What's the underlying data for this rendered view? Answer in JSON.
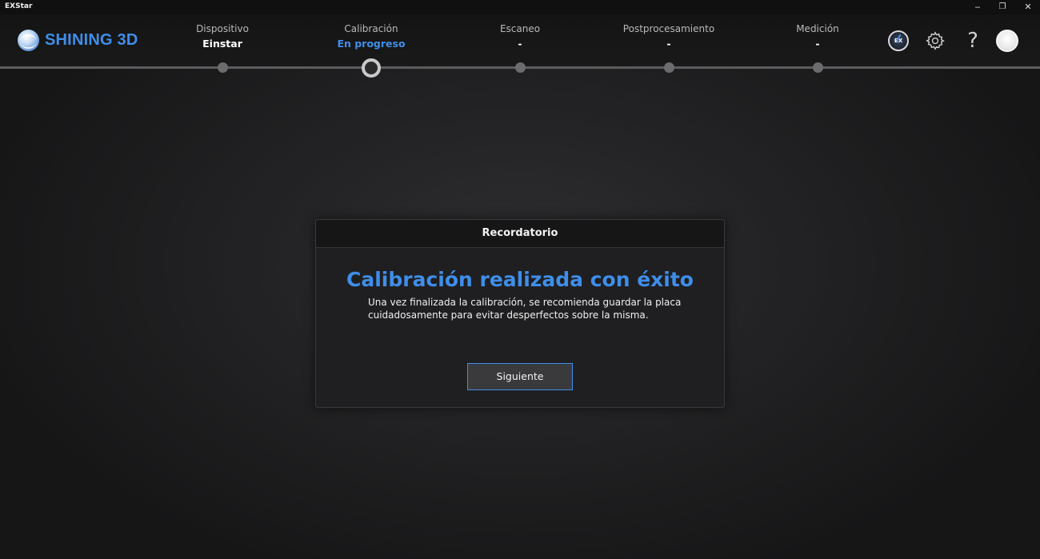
{
  "window": {
    "title": "EXStar",
    "minimize_label": "‒",
    "restore_label": "❐",
    "close_label": "✕"
  },
  "header": {
    "logo_text": "SHINING 3D",
    "steps": [
      {
        "title": "Dispositivo",
        "value": "Einstar",
        "active": false
      },
      {
        "title": "Calibración",
        "value": "En progreso",
        "active": true
      },
      {
        "title": "Escaneo",
        "value": "-",
        "active": false
      },
      {
        "title": "Postprocesamiento",
        "value": "-",
        "active": false
      },
      {
        "title": "Medición",
        "value": "-",
        "active": false
      }
    ],
    "icons": {
      "model_label": "EX",
      "help_glyph": "?"
    }
  },
  "dialog": {
    "header": "Recordatorio",
    "title": "Calibración realizada con éxito",
    "message": "Una vez finalizada la calibración, se recomienda guardar la placa cuidadosamente para evitar desperfectos sobre la misma.",
    "button_label": "Siguiente"
  },
  "colors": {
    "accent": "#3f8ee8",
    "background": "#1d1d1f"
  }
}
